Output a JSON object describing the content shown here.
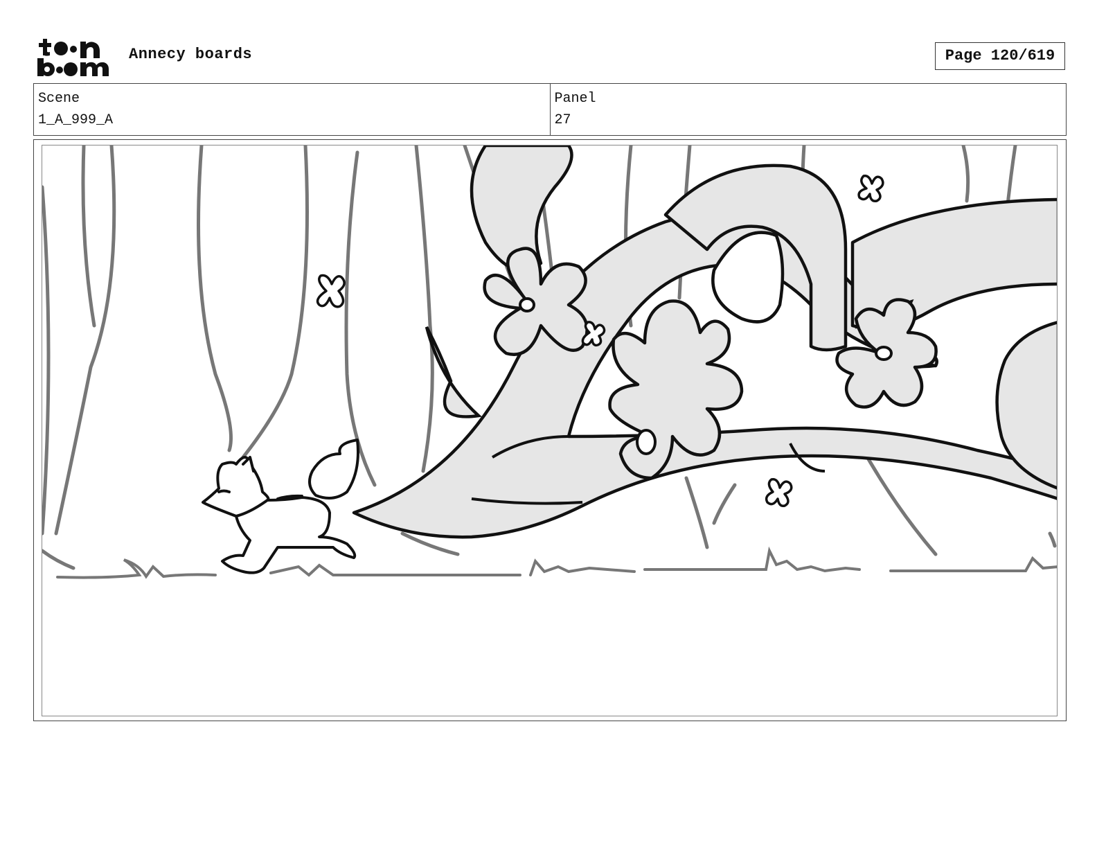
{
  "header": {
    "logo_alt": "toon boom",
    "title": "Annecy boards",
    "page": "Page 120/619"
  },
  "info": {
    "scene_label": "Scene",
    "scene_value": "1_A_999_A",
    "panel_label": "Panel",
    "panel_value": "27"
  },
  "panel_drawing": {
    "description_icon": "storyboard-sketch-image"
  }
}
